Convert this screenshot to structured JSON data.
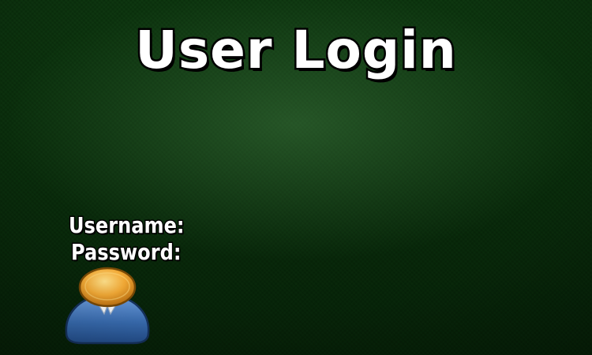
{
  "login": {
    "title": "User Login",
    "username_label": "Username:",
    "password_label": "Password:"
  },
  "icons": {
    "avatar": "user-avatar-icon"
  },
  "colors": {
    "background": "#2f6a34",
    "title_text": "#ffffff",
    "title_outline": "#000000",
    "avatar_head": "#f0a030",
    "avatar_body": "#3a6fb5"
  }
}
